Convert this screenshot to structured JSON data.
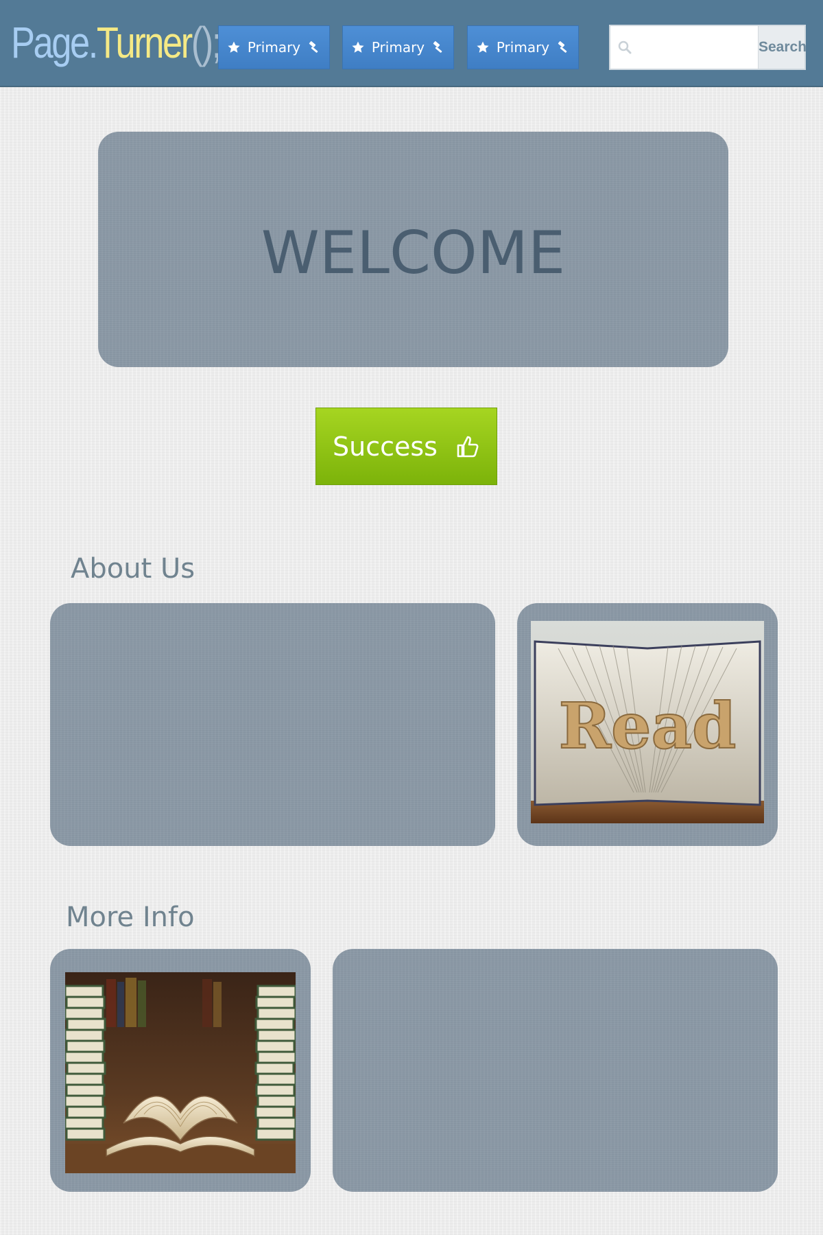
{
  "header": {
    "logo": {
      "part1": "Page.",
      "part2": "Turner",
      "part3": "();"
    },
    "nav_buttons": [
      {
        "label": "Primary",
        "left_icon": "star-icon",
        "right_icon": "hammer-icon"
      },
      {
        "label": "Primary",
        "left_icon": "star-icon",
        "right_icon": "hammer-icon"
      },
      {
        "label": "Primary",
        "left_icon": "star-icon",
        "right_icon": "hammer-icon"
      }
    ],
    "search": {
      "value": "",
      "placeholder": "",
      "button_label": "Search",
      "icon": "search-icon"
    }
  },
  "hero": {
    "title": "WELCOME"
  },
  "cta": {
    "label": "Success",
    "icon": "thumbs-up-icon"
  },
  "about": {
    "title": "About Us",
    "image": "folded-book-read-sculpture"
  },
  "more": {
    "title": "More Info",
    "image": "open-books-on-table"
  },
  "colors": {
    "navbar": "#537a96",
    "primary_button": "#4e8fd6",
    "success_button": "#8bc314",
    "panel": "#8a98a5",
    "welcome_text": "#4a5e70",
    "section_title": "#70838f",
    "logo_blue": "#a7cdf2",
    "logo_yellow": "#f5e985"
  }
}
